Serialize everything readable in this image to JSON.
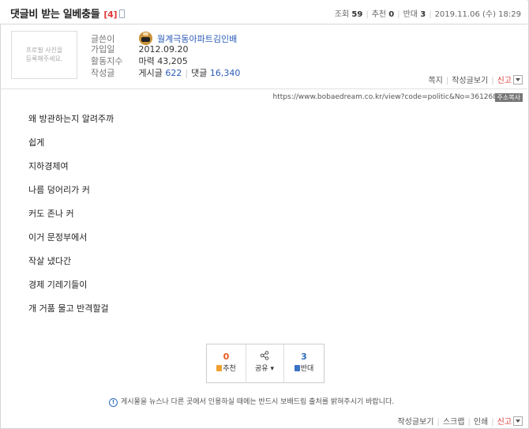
{
  "post": {
    "title": "댓글비 받는 일베충들",
    "comment_count": "[4]",
    "views_label": "조회",
    "views": "59",
    "recommend_label": "추천",
    "recommend": "0",
    "oppose_label": "반대",
    "oppose": "3",
    "datetime": "2019.11.06 (수) 18:29"
  },
  "author": {
    "profile_placeholder_line1": "프로필 사진을",
    "profile_placeholder_line2": "등록해주세요.",
    "label_writer": "글쓴이",
    "nickname": "월계극동아파트김인배",
    "label_joined": "가입일",
    "joined": "2012.09.20",
    "label_activity": "활동지수",
    "activity": "마력 43,205",
    "label_posts": "작성글",
    "posts_label": "게시글",
    "posts": "622",
    "comments_label": "댓글",
    "comments": "16,340"
  },
  "author_actions": {
    "message": "쪽지",
    "view_posts": "작성글보기",
    "report": "신고"
  },
  "url_bar": {
    "url": "https://www.bobaedream.co.kr/view?code=politic&No=361268",
    "copy_label": "주소복사"
  },
  "body": [
    "왜 방관하는지 알려주까",
    "쉽게",
    "지하경제여",
    "나름 덩어리가 커",
    "커도 존나 커",
    "이거 문정부에서",
    "작살 냈다간",
    "경제 기레기들이",
    "개 거품 물고 반격할걸"
  ],
  "vote": {
    "up_count": "0",
    "up_label": "추천",
    "share_label": "공유",
    "down_count": "3",
    "down_label": "반대"
  },
  "notice": "게시물을 뉴스나 다른 곳에서 인용하실 때에는 반드시 보배드림 출처를 밝혀주시기 바랍니다.",
  "bottom_actions": {
    "view_posts": "작성글보기",
    "scrap": "스크랩",
    "print": "인쇄",
    "report": "신고"
  }
}
